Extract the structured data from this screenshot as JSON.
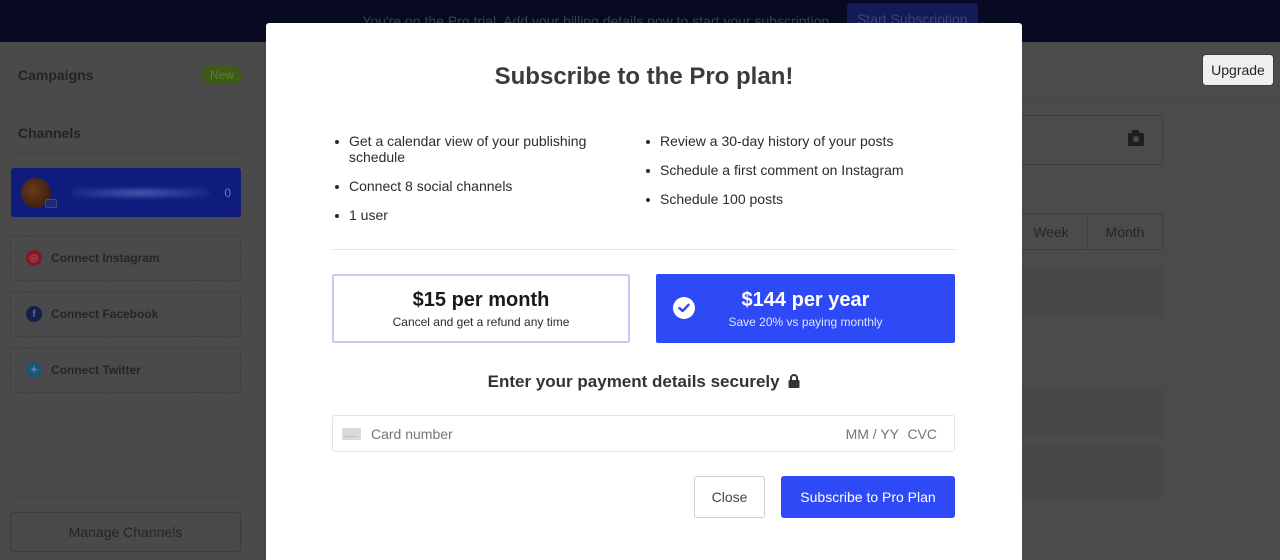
{
  "banner": {
    "text": "You're on the Pro trial. Add your billing details now to start your subscription.",
    "button_label": "Start Subscription"
  },
  "sidebar": {
    "campaigns_label": "Campaigns",
    "campaigns_badge": "New",
    "channels_label": "Channels",
    "active_channel": {
      "name": "",
      "count": "0"
    },
    "connect_buttons": [
      {
        "label": "Connect Instagram",
        "icon": "instagram-icon",
        "color": "#c1223b"
      },
      {
        "label": "Connect Facebook",
        "icon": "facebook-icon",
        "color": "#1c2c5c"
      },
      {
        "label": "Connect Twitter",
        "icon": "twitter-icon",
        "color": "#1f6a93"
      }
    ],
    "manage_label": "Manage Channels"
  },
  "main": {
    "upgrade_label": "Upgrade",
    "view_options": [
      "Week",
      "Month"
    ]
  },
  "modal": {
    "title": "Subscribe to the Pro plan!",
    "features_left": [
      "Get a calendar view of your publishing schedule",
      "Connect 8 social channels",
      "1 user"
    ],
    "features_right": [
      "Review a 30-day history of your posts",
      "Schedule a first comment on Instagram",
      "Schedule 100 posts"
    ],
    "plans": [
      {
        "price": "$15 per month",
        "subtitle": "Cancel and get a refund any time",
        "selected": false
      },
      {
        "price": "$144 per year",
        "subtitle": "Save 20% vs paying monthly",
        "selected": true
      }
    ],
    "payment_heading": "Enter your payment details securely",
    "card": {
      "number_placeholder": "Card number",
      "expiry_placeholder": "MM / YY",
      "cvc_placeholder": "CVC"
    },
    "close_label": "Close",
    "subscribe_label": "Subscribe to Pro Plan"
  },
  "colors": {
    "accent": "#2e49f6",
    "overlay_bg": "#4b4b4b",
    "banner_bg": "#080a22"
  }
}
